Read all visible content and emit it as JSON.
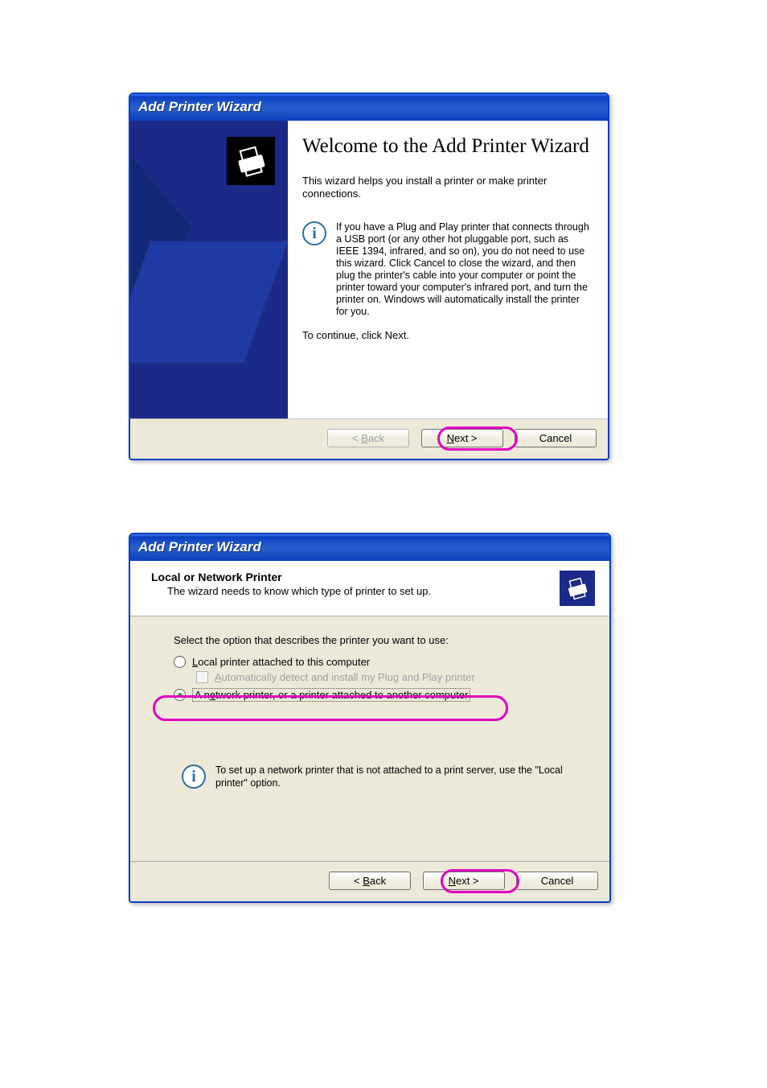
{
  "dialog1": {
    "title": "Add Printer Wizard",
    "heading": "Welcome to the Add Printer Wizard",
    "intro": "This wizard helps you install a printer or make printer connections.",
    "info": "If you have a Plug and Play printer that connects through a USB port (or any other hot pluggable port, such as IEEE 1394, infrared, and so on), you do not need to use this wizard. Click Cancel to close the wizard, and then plug the printer's cable into your computer or point the printer toward your computer's infrared port, and turn the printer on. Windows will automatically install the printer for you.",
    "continue_text": "To continue, click Next.",
    "buttons": {
      "back_prefix": "< ",
      "back_letter": "B",
      "back_rest": "ack",
      "next_letter": "N",
      "next_rest": "ext >",
      "cancel": "Cancel"
    },
    "highlighted_button": "next"
  },
  "dialog2": {
    "title": "Add Printer Wizard",
    "header_title": "Local or Network Printer",
    "header_subtitle": "The wizard needs to know which type of printer to set up.",
    "prompt": "Select the option that describes the printer you want to use:",
    "option1": {
      "letter": "L",
      "rest": "ocal printer attached to this computer",
      "selected": false
    },
    "option1_sub": {
      "letter": "A",
      "rest": "utomatically detect and install my Plug and Play printer",
      "checked": false,
      "enabled": false
    },
    "option2": {
      "prefix": "A n",
      "letter": "e",
      "rest": "twork printer, or a printer attached to another computer",
      "selected": true,
      "highlighted": true
    },
    "info": "To set up a network printer that is not attached to a print server, use the \"Local printer\" option.",
    "buttons": {
      "back_prefix": "< ",
      "back_letter": "B",
      "back_rest": "ack",
      "next_letter": "N",
      "next_rest": "ext >",
      "cancel": "Cancel"
    },
    "highlighted_button": "next"
  }
}
